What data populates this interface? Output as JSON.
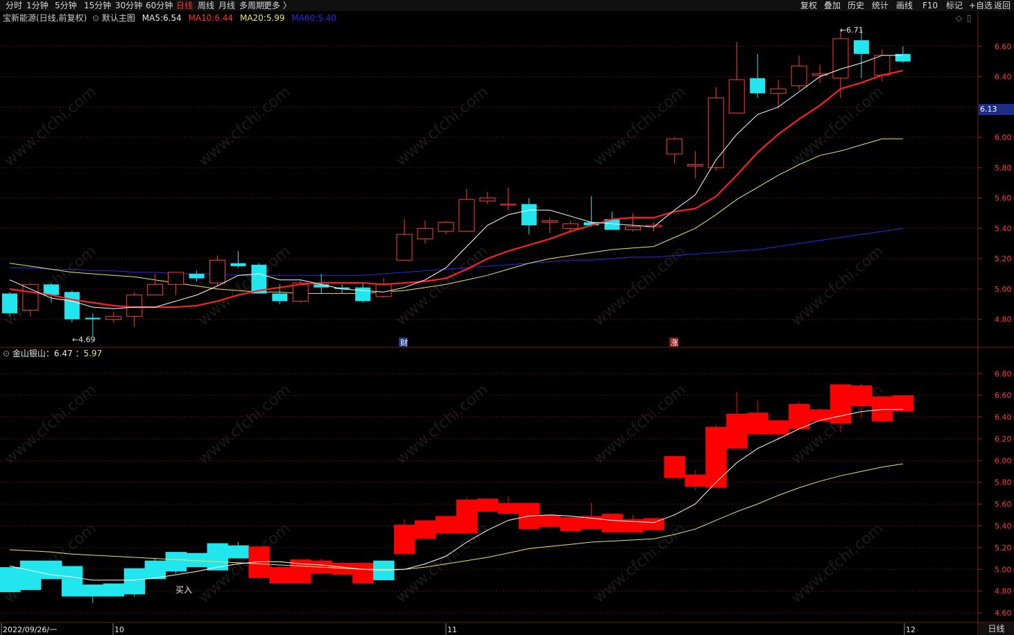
{
  "toolbar": {
    "periods": [
      "分时",
      "1分钟",
      "5分钟",
      "15分钟",
      "30分钟",
      "60分钟",
      "日线",
      "周线",
      "月线",
      "多周期",
      "更多 〉"
    ],
    "active_period": "日线",
    "right_buttons": [
      "复权",
      "叠加",
      "历史",
      "统计",
      "画线",
      "F10",
      "标记",
      "+自选",
      "返回"
    ]
  },
  "main_header": {
    "stock": "宝新能源(日线,前复权)",
    "template": "默认主图",
    "ma5_label": "MA5:",
    "ma5_value": "6.54",
    "ma10_label": "MA10:",
    "ma10_value": "6.44",
    "ma20_label": "MA20:",
    "ma20_value": "5.99",
    "ma60_label": "MA60:",
    "ma60_value": "5.40",
    "ma_colors": {
      "ma5": "#ffffff",
      "ma10": "#ff2020",
      "ma20": "#e8e860",
      "ma60": "#2a2ae8"
    }
  },
  "sub_header": {
    "indicator": "金山银山：",
    "value1": "6.47",
    "sep": "：",
    "value2": "5.97"
  },
  "annotations": {
    "low_label": "←4.69",
    "high_label": "←6.71",
    "buy_label": "买入",
    "event_cai": "财",
    "event_zhang": "涨"
  },
  "current_price": "6.13",
  "bottom_right": "日线",
  "date_labels": [
    "2022/09/26/一",
    "10",
    "11",
    "12"
  ],
  "watermark": "www.cfchi.com",
  "chart_data": [
    {
      "type": "candlestick",
      "name": "main",
      "y_ticks": [
        "6.60",
        "6.40",
        "6.20",
        "6.00",
        "5.80",
        "5.60",
        "5.40",
        "5.20",
        "5.00",
        "4.80"
      ],
      "ylim": [
        4.62,
        6.75
      ],
      "candles": [
        {
          "o": 4.97,
          "c": 4.84,
          "h": 4.98,
          "l": 4.82
        },
        {
          "o": 4.86,
          "c": 5.03,
          "h": 5.04,
          "l": 4.82
        },
        {
          "o": 5.03,
          "c": 4.96,
          "h": 5.04,
          "l": 4.91
        },
        {
          "o": 4.98,
          "c": 4.8,
          "h": 4.99,
          "l": 4.78
        },
        {
          "o": 4.81,
          "c": 4.8,
          "h": 4.84,
          "l": 4.69
        },
        {
          "o": 4.8,
          "c": 4.82,
          "h": 4.85,
          "l": 4.78
        },
        {
          "o": 4.82,
          "c": 4.96,
          "h": 4.98,
          "l": 4.75
        },
        {
          "o": 4.96,
          "c": 5.03,
          "h": 5.1,
          "l": 4.96
        },
        {
          "o": 5.03,
          "c": 5.11,
          "h": 5.11,
          "l": 4.96
        },
        {
          "o": 5.1,
          "c": 5.07,
          "h": 5.12,
          "l": 5.05
        },
        {
          "o": 5.04,
          "c": 5.19,
          "h": 5.22,
          "l": 5.02
        },
        {
          "o": 5.17,
          "c": 5.15,
          "h": 5.25,
          "l": 5.14
        },
        {
          "o": 5.16,
          "c": 4.97,
          "h": 5.17,
          "l": 4.97
        },
        {
          "o": 4.97,
          "c": 4.92,
          "h": 5.03,
          "l": 4.9
        },
        {
          "o": 4.92,
          "c": 5.04,
          "h": 5.06,
          "l": 4.91
        },
        {
          "o": 5.03,
          "c": 5.01,
          "h": 5.1,
          "l": 4.97
        },
        {
          "o": 5.01,
          "c": 5.0,
          "h": 5.03,
          "l": 4.97
        },
        {
          "o": 5.01,
          "c": 4.92,
          "h": 5.04,
          "l": 4.91
        },
        {
          "o": 4.95,
          "c": 5.03,
          "h": 5.07,
          "l": 4.94
        },
        {
          "o": 5.19,
          "c": 5.36,
          "h": 5.46,
          "l": 5.19
        },
        {
          "o": 5.33,
          "c": 5.4,
          "h": 5.45,
          "l": 5.3
        },
        {
          "o": 5.38,
          "c": 5.44,
          "h": 5.45,
          "l": 5.36
        },
        {
          "o": 5.38,
          "c": 5.59,
          "h": 5.66,
          "l": 5.38
        },
        {
          "o": 5.58,
          "c": 5.6,
          "h": 5.64,
          "l": 5.56
        },
        {
          "o": 5.56,
          "c": 5.56,
          "h": 5.67,
          "l": 5.52
        },
        {
          "o": 5.56,
          "c": 5.42,
          "h": 5.6,
          "l": 5.36
        },
        {
          "o": 5.44,
          "c": 5.45,
          "h": 5.47,
          "l": 5.37
        },
        {
          "o": 5.4,
          "c": 5.43,
          "h": 5.45,
          "l": 5.37
        },
        {
          "o": 5.44,
          "c": 5.42,
          "h": 5.61,
          "l": 5.41
        },
        {
          "o": 5.46,
          "c": 5.39,
          "h": 5.51,
          "l": 5.39
        },
        {
          "o": 5.39,
          "c": 5.41,
          "h": 5.5,
          "l": 5.38
        },
        {
          "o": 5.41,
          "c": 5.42,
          "h": 5.44,
          "l": 5.38
        },
        {
          "o": 5.89,
          "c": 5.99,
          "h": 6.0,
          "l": 5.83
        },
        {
          "o": 5.81,
          "c": 5.82,
          "h": 5.91,
          "l": 5.73
        },
        {
          "o": 5.8,
          "c": 6.26,
          "h": 6.33,
          "l": 5.78
        },
        {
          "o": 6.16,
          "c": 6.38,
          "h": 6.63,
          "l": 6.16
        },
        {
          "o": 6.39,
          "c": 6.29,
          "h": 6.55,
          "l": 6.26
        },
        {
          "o": 6.29,
          "c": 6.32,
          "h": 6.38,
          "l": 6.19
        },
        {
          "o": 6.34,
          "c": 6.47,
          "h": 6.54,
          "l": 6.31
        },
        {
          "o": 6.41,
          "c": 6.42,
          "h": 6.48,
          "l": 6.36
        },
        {
          "o": 6.39,
          "c": 6.65,
          "h": 6.71,
          "l": 6.26
        },
        {
          "o": 6.64,
          "c": 6.55,
          "h": 6.71,
          "l": 6.39
        },
        {
          "o": 6.41,
          "c": 6.54,
          "h": 6.58,
          "l": 6.37
        },
        {
          "o": 6.55,
          "c": 6.5,
          "h": 6.6,
          "l": 6.49
        }
      ],
      "series": [
        {
          "name": "MA5",
          "values": [
            5.06,
            5.0,
            4.94,
            4.92,
            4.88,
            4.87,
            4.88,
            4.88,
            4.92,
            4.96,
            5.02,
            5.09,
            5.1,
            5.06,
            5.06,
            5.03,
            5.0,
            4.99,
            4.98,
            5.01,
            5.06,
            5.14,
            5.28,
            5.42,
            5.49,
            5.52,
            5.52,
            5.48,
            5.44,
            5.43,
            5.42,
            5.41,
            5.52,
            5.62,
            5.85,
            6.02,
            6.15,
            6.2,
            6.3,
            6.4,
            6.45,
            6.49,
            6.54,
            6.54
          ]
        },
        {
          "name": "MA10",
          "values": [
            5.0,
            4.98,
            4.96,
            4.93,
            4.91,
            4.89,
            4.88,
            4.88,
            4.88,
            4.89,
            4.92,
            4.96,
            4.99,
            5.01,
            5.03,
            5.04,
            5.04,
            5.04,
            5.03,
            5.04,
            5.05,
            5.07,
            5.13,
            5.2,
            5.25,
            5.29,
            5.33,
            5.38,
            5.42,
            5.46,
            5.47,
            5.47,
            5.51,
            5.53,
            5.61,
            5.75,
            5.9,
            6.02,
            6.12,
            6.21,
            6.32,
            6.36,
            6.41,
            6.44
          ]
        },
        {
          "name": "MA20",
          "values": [
            5.17,
            5.15,
            5.13,
            5.11,
            5.1,
            5.09,
            5.08,
            5.06,
            5.04,
            5.02,
            5.0,
            4.99,
            4.98,
            4.98,
            4.97,
            4.97,
            4.97,
            4.97,
            4.98,
            4.99,
            5.01,
            5.03,
            5.06,
            5.09,
            5.13,
            5.17,
            5.2,
            5.22,
            5.24,
            5.26,
            5.27,
            5.28,
            5.34,
            5.4,
            5.49,
            5.59,
            5.67,
            5.75,
            5.82,
            5.88,
            5.91,
            5.95,
            5.99,
            5.99
          ]
        },
        {
          "name": "MA60",
          "values": [
            5.14,
            5.14,
            5.13,
            5.13,
            5.12,
            5.12,
            5.11,
            5.11,
            5.1,
            5.1,
            5.1,
            5.09,
            5.09,
            5.09,
            5.09,
            5.09,
            5.09,
            5.09,
            5.1,
            5.11,
            5.12,
            5.13,
            5.14,
            5.15,
            5.16,
            5.17,
            5.18,
            5.19,
            5.19,
            5.2,
            5.21,
            5.21,
            5.22,
            5.23,
            5.24,
            5.25,
            5.26,
            5.28,
            5.3,
            5.32,
            5.34,
            5.36,
            5.38,
            5.4
          ]
        }
      ]
    },
    {
      "type": "bar",
      "name": "金山银山",
      "y_ticks": [
        "6.80",
        "6.60",
        "6.40",
        "6.20",
        "6.00",
        "5.80",
        "5.60",
        "5.40",
        "5.20",
        "5.00",
        "4.80",
        "4.60"
      ],
      "ylim": [
        4.53,
        6.92
      ],
      "lines": [
        {
          "name": "value1",
          "values": [
            5.03,
            4.99,
            4.95,
            4.93,
            4.9,
            4.9,
            4.9,
            4.92,
            4.95,
            4.98,
            5.02,
            5.05,
            5.07,
            5.07,
            5.05,
            5.04,
            5.02,
            5.0,
            4.99,
            5.0,
            5.05,
            5.12,
            5.25,
            5.36,
            5.45,
            5.49,
            5.5,
            5.49,
            5.47,
            5.45,
            5.44,
            5.43,
            5.5,
            5.6,
            5.8,
            5.98,
            6.11,
            6.2,
            6.29,
            6.37,
            6.41,
            6.45,
            6.47,
            6.47
          ]
        },
        {
          "name": "value2",
          "values": [
            5.18,
            5.17,
            5.16,
            5.14,
            5.13,
            5.12,
            5.11,
            5.1,
            5.09,
            5.08,
            5.07,
            5.06,
            5.05,
            5.04,
            5.03,
            5.02,
            5.01,
            5.0,
            5.0,
            5.0,
            5.02,
            5.05,
            5.08,
            5.11,
            5.15,
            5.19,
            5.21,
            5.23,
            5.25,
            5.26,
            5.27,
            5.28,
            5.32,
            5.37,
            5.45,
            5.53,
            5.6,
            5.68,
            5.75,
            5.81,
            5.86,
            5.9,
            5.94,
            5.97
          ]
        }
      ]
    }
  ]
}
